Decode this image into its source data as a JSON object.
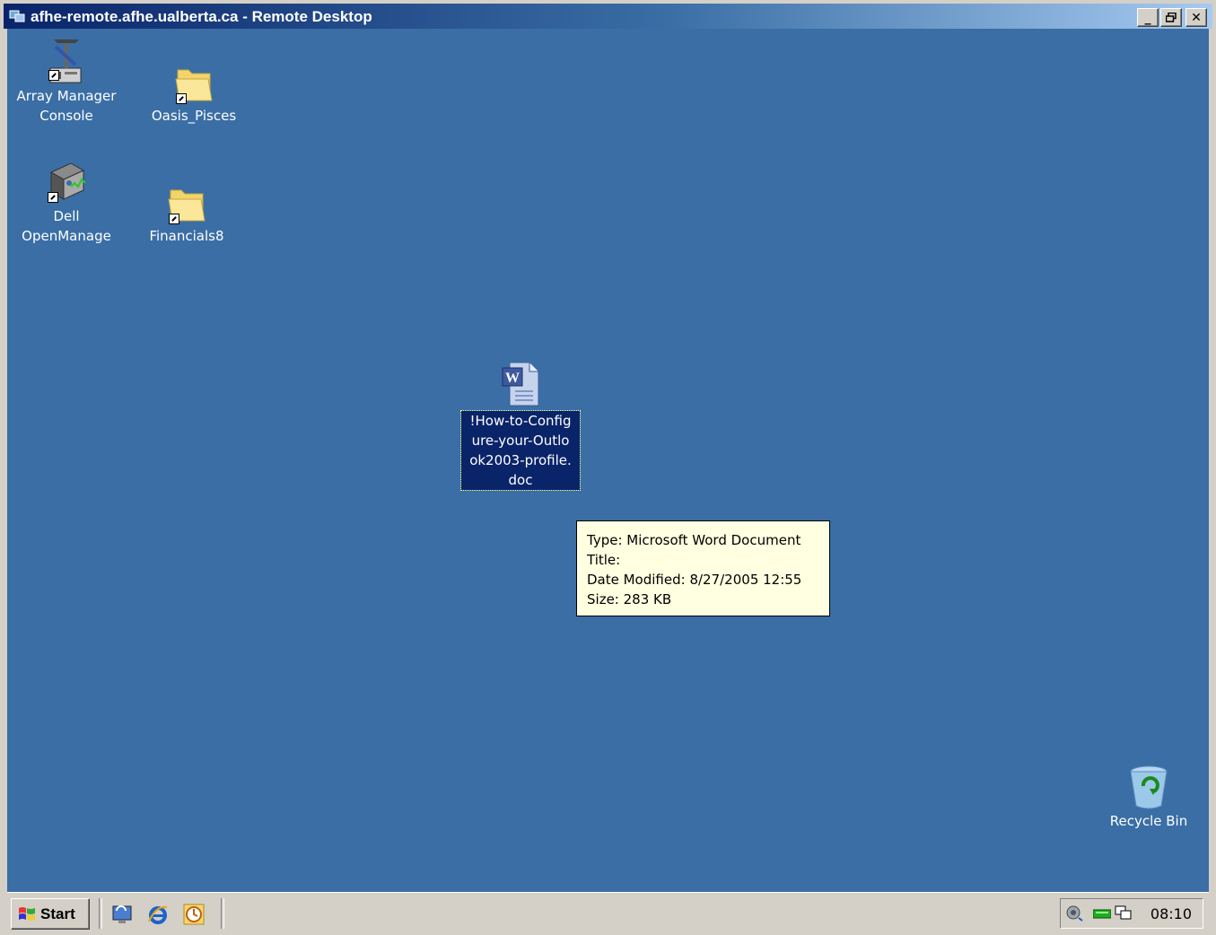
{
  "window": {
    "title": "afhe-remote.afhe.ualberta.ca - Remote Desktop",
    "buttons": {
      "minimize": "_",
      "restore": "🗗",
      "close": "✕"
    }
  },
  "desktop": {
    "background": "#3a6ea5",
    "icons": [
      {
        "label": "Array Manager\nConsole",
        "icon": "array-manager-icon"
      },
      {
        "label": "Oasis_Pisces",
        "icon": "folder-icon"
      },
      {
        "label": "Dell\nOpenManage",
        "icon": "dell-openmanage-icon"
      },
      {
        "label": "Financials8",
        "icon": "folder-icon"
      },
      {
        "label": "!How-to-Config\nure-your-Outlo\nok2003-profile.\ndoc",
        "icon": "word-document-icon"
      },
      {
        "label": "Recycle Bin",
        "icon": "recycle-bin-icon"
      }
    ]
  },
  "tooltip": {
    "type": "Type: Microsoft Word Document",
    "title": "Title:",
    "date_modified": "Date Modified: 8/27/2005 12:55",
    "size": "Size: 283 KB"
  },
  "taskbar": {
    "start_label": "Start",
    "quick_launch": [
      "desktop-icon",
      "internet-explorer-icon",
      "clock-app-icon"
    ],
    "tray_icons": [
      "speaker-icon",
      "network-icon",
      "monitor-icon"
    ],
    "clock": "08:10"
  }
}
